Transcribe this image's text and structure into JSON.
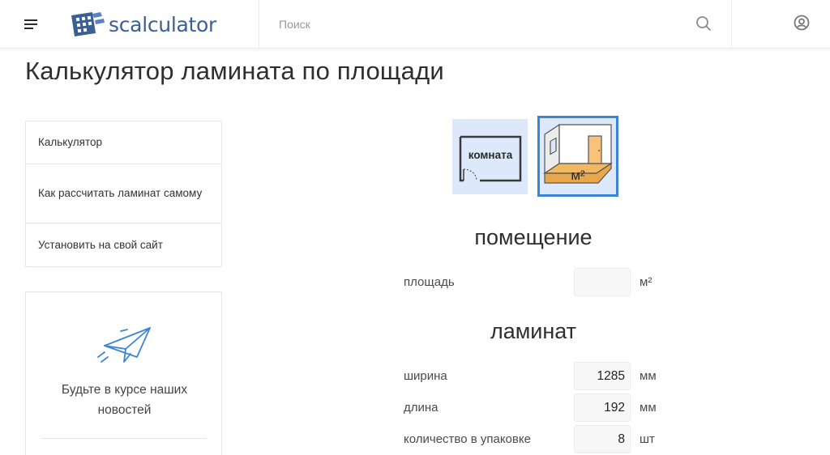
{
  "header": {
    "logo_text": "scalculator",
    "search_placeholder": "Поиск",
    "icons": {
      "menu": "hamburger-menu-icon",
      "search": "magnifier-icon",
      "user": "user-circle-icon"
    }
  },
  "page_title": "Калькулятор ламината по площади",
  "sidebar": {
    "items": [
      {
        "label": "Калькулятор"
      },
      {
        "label": "Как рассчитать ламинат самому"
      },
      {
        "label": "Установить на свой сайт"
      }
    ],
    "news_text": "Будьте в курсе наших новостей"
  },
  "modes": {
    "room_label": "комната",
    "area_label": "м²",
    "selected": "area"
  },
  "room_section": {
    "title": "помещение",
    "area": {
      "label": "площадь",
      "value": "",
      "unit": "м²"
    }
  },
  "laminate_section": {
    "title": "ламинат",
    "width": {
      "label": "ширина",
      "value": "1285",
      "unit": "мм"
    },
    "length": {
      "label": "длина",
      "value": "192",
      "unit": "мм"
    },
    "pack_count": {
      "label": "количество в упаковке",
      "value": "8",
      "unit": "шт"
    }
  },
  "colors": {
    "accent": "#3d84d6",
    "logo": "#3a5f94",
    "mode_bg": "#dde9fa"
  }
}
